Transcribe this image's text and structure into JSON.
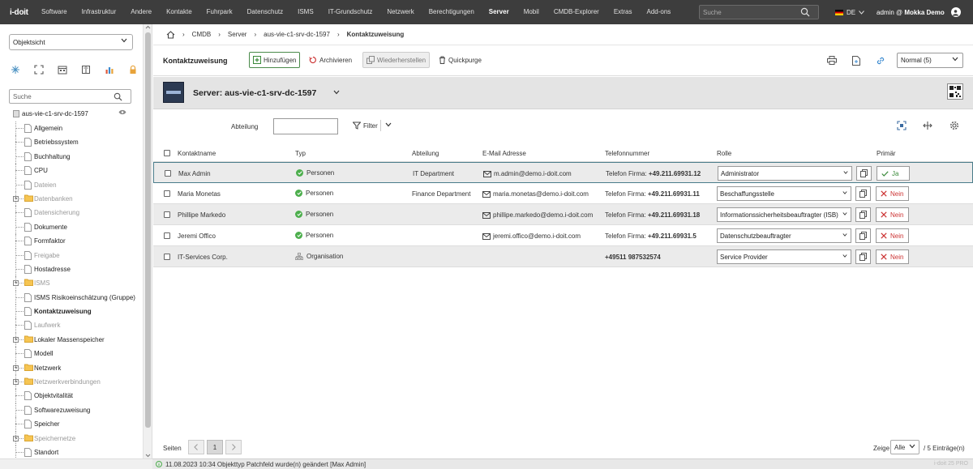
{
  "app": {
    "logo": "i-doit"
  },
  "nav": {
    "items": [
      "Software",
      "Infrastruktur",
      "Andere",
      "Kontakte",
      "Fuhrpark",
      "Datenschutz",
      "ISMS",
      "IT-Grundschutz",
      "Netzwerk",
      "Berechtigungen",
      "Server",
      "Mobil",
      "CMDB-Explorer",
      "Extras",
      "Add-ons"
    ],
    "active": "Server",
    "search_placeholder": "Suche",
    "lang": "DE",
    "user": "admin @",
    "tenant": "Mokka Demo"
  },
  "sidebar": {
    "view_select": "Objektsicht",
    "search_placeholder": "Suche",
    "root": "aus-vie-c1-srv-dc-1597",
    "items": [
      {
        "label": "Allgemein",
        "type": "doc",
        "state": "normal"
      },
      {
        "label": "Betriebssystem",
        "type": "doc",
        "state": "normal"
      },
      {
        "label": "Buchhaltung",
        "type": "doc",
        "state": "normal"
      },
      {
        "label": "CPU",
        "type": "doc",
        "state": "normal"
      },
      {
        "label": "Dateien",
        "type": "doc",
        "state": "gray"
      },
      {
        "label": "Datenbanken",
        "type": "folder",
        "state": "gray"
      },
      {
        "label": "Datensicherung",
        "type": "doc",
        "state": "gray"
      },
      {
        "label": "Dokumente",
        "type": "doc",
        "state": "normal"
      },
      {
        "label": "Formfaktor",
        "type": "doc",
        "state": "normal"
      },
      {
        "label": "Freigabe",
        "type": "doc",
        "state": "gray"
      },
      {
        "label": "Hostadresse",
        "type": "doc",
        "state": "normal"
      },
      {
        "label": "ISMS",
        "type": "folder",
        "state": "gray"
      },
      {
        "label": "ISMS Risikoeinschätzung (Gruppe)",
        "type": "doc",
        "state": "normal"
      },
      {
        "label": "Kontaktzuweisung",
        "type": "doc",
        "state": "bold"
      },
      {
        "label": "Laufwerk",
        "type": "doc",
        "state": "gray"
      },
      {
        "label": "Lokaler Massenspeicher",
        "type": "folder",
        "state": "normal"
      },
      {
        "label": "Modell",
        "type": "doc",
        "state": "normal"
      },
      {
        "label": "Netzwerk",
        "type": "folder",
        "state": "normal"
      },
      {
        "label": "Netzwerkverbindungen",
        "type": "folder",
        "state": "gray"
      },
      {
        "label": "Objektvitalität",
        "type": "doc",
        "state": "normal"
      },
      {
        "label": "Softwarezuweisung",
        "type": "doc",
        "state": "normal"
      },
      {
        "label": "Speicher",
        "type": "doc",
        "state": "normal"
      },
      {
        "label": "Speichernetze",
        "type": "folder",
        "state": "gray"
      },
      {
        "label": "Standort",
        "type": "doc",
        "state": "normal"
      }
    ]
  },
  "breadcrumb": [
    "CMDB",
    "Server",
    "aus-vie-c1-srv-dc-1597",
    "Kontaktzuweisung"
  ],
  "toolbar": {
    "title": "Kontaktzuweisung",
    "add": "Hinzufügen",
    "archive": "Archivieren",
    "restore": "Wiederherstellen",
    "purge": "Quickpurge",
    "view_mode": "Normal (5)"
  },
  "object": {
    "title": "Server: aus-vie-c1-srv-dc-1597"
  },
  "filter": {
    "label": "Abteilung",
    "button": "Filter"
  },
  "table": {
    "headers": [
      "Kontaktname",
      "Typ",
      "Abteilung",
      "E-Mail Adresse",
      "Telefonnummer",
      "Rolle",
      "Primär"
    ],
    "rows": [
      {
        "name": "Max Admin",
        "type": "Personen",
        "dept": "IT Department",
        "email": "m.admin@demo.i-doit.com",
        "phone_prefix": "Telefon Firma:",
        "phone": "+49.211.69931.12",
        "role": "Administrator",
        "primary": "Ja"
      },
      {
        "name": "Maria Monetas",
        "type": "Personen",
        "dept": "Finance Department",
        "email": "maria.monetas@demo.i-doit.com",
        "phone_prefix": "Telefon Firma:",
        "phone": "+49.211.69931.11",
        "role": "Beschaffungsstelle",
        "primary": "Nein"
      },
      {
        "name": "Phillipe Markedo",
        "type": "Personen",
        "dept": "",
        "email": "phillipe.markedo@demo.i-doit.com",
        "phone_prefix": "Telefon Firma:",
        "phone": "+49.211.69931.18",
        "role": "Informationssicherheitsbeauftragter (ISB)",
        "primary": "Nein"
      },
      {
        "name": "Jeremi Offico",
        "type": "Personen",
        "dept": "",
        "email": "jeremi.offico@demo.i-doit.com",
        "phone_prefix": "Telefon Firma:",
        "phone": "+49.211.69931.5",
        "role": "Datenschutzbeauftragter",
        "primary": "Nein"
      },
      {
        "name": "IT-Services Corp.",
        "type": "Organisation",
        "dept": "",
        "email": "",
        "phone_prefix": "",
        "phone": "+49511 987532574",
        "role": "Service Provider",
        "primary": "Nein"
      }
    ]
  },
  "pager": {
    "label": "Seiten",
    "current": "1",
    "show_label": "Zeige",
    "show_value": "Alle",
    "entries": "/ 5 Einträge(n)"
  },
  "status": {
    "message": "11.08.2023 10:34 Objekttyp Patchfeld wurde(n) geändert [Max Admin]",
    "version": "i-doit 25 PRO"
  }
}
